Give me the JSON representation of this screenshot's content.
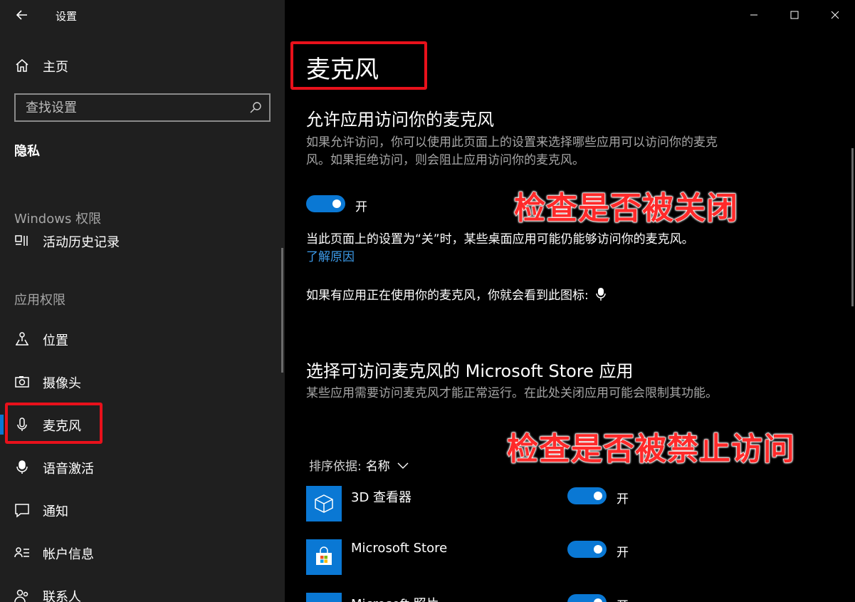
{
  "window": {
    "title": "设置"
  },
  "sidebar": {
    "home_label": "主页",
    "search_placeholder": "查找设置",
    "section_title": "隐私",
    "windows_group": "Windows 权限",
    "activity_history": "活动历史记录",
    "apps_group": "应用权限",
    "items": [
      {
        "label": "位置",
        "icon": "location-icon"
      },
      {
        "label": "摄像头",
        "icon": "camera-icon"
      },
      {
        "label": "麦克风",
        "icon": "microphone-icon",
        "selected": true
      },
      {
        "label": "语音激活",
        "icon": "voice-activation-icon"
      },
      {
        "label": "通知",
        "icon": "notification-icon"
      },
      {
        "label": "帐户信息",
        "icon": "account-info-icon"
      },
      {
        "label": "联系人",
        "icon": "contacts-icon"
      }
    ]
  },
  "main": {
    "page_title": "麦克风",
    "allow_heading": "允许应用访问你的麦克风",
    "allow_desc": "如果允许访问，你可以使用此页面上的设置来选择哪些应用可以访问你的麦克风。如果拒绝访问，则会阻止应用访问你的麦克风。",
    "allow_toggle_state": "开",
    "desktop_note": "当此页面上的设置为“关”时，某些桌面应用可能仍能够访问你的麦克风。",
    "learn_why_link": "了解原因",
    "icon_note": "如果有应用正在使用你的麦克风，你就会看到此图标:",
    "store_heading": "选择可访问麦克风的 Microsoft Store 应用",
    "store_desc": "某些应用需要访问麦克风才能正常运行。在此处关闭应用可能会限制其功能。",
    "sort_label": "排序依据:",
    "sort_value": "名称",
    "apps": [
      {
        "name": "3D 查看器",
        "state": "开",
        "icon": "cube-icon"
      },
      {
        "name": "Microsoft Store",
        "state": "开",
        "icon": "store-bag-icon"
      },
      {
        "name": "Microsoft 照片",
        "state": "开",
        "icon": "photos-icon"
      }
    ]
  },
  "annotations": {
    "check_closed": "检查是否被关闭",
    "check_denied": "检查是否被禁止访问",
    "color": "#e8111b"
  },
  "colors": {
    "accent": "#0a78d4",
    "sidebar_bg": "#1f1f1f",
    "main_bg": "#000000"
  }
}
